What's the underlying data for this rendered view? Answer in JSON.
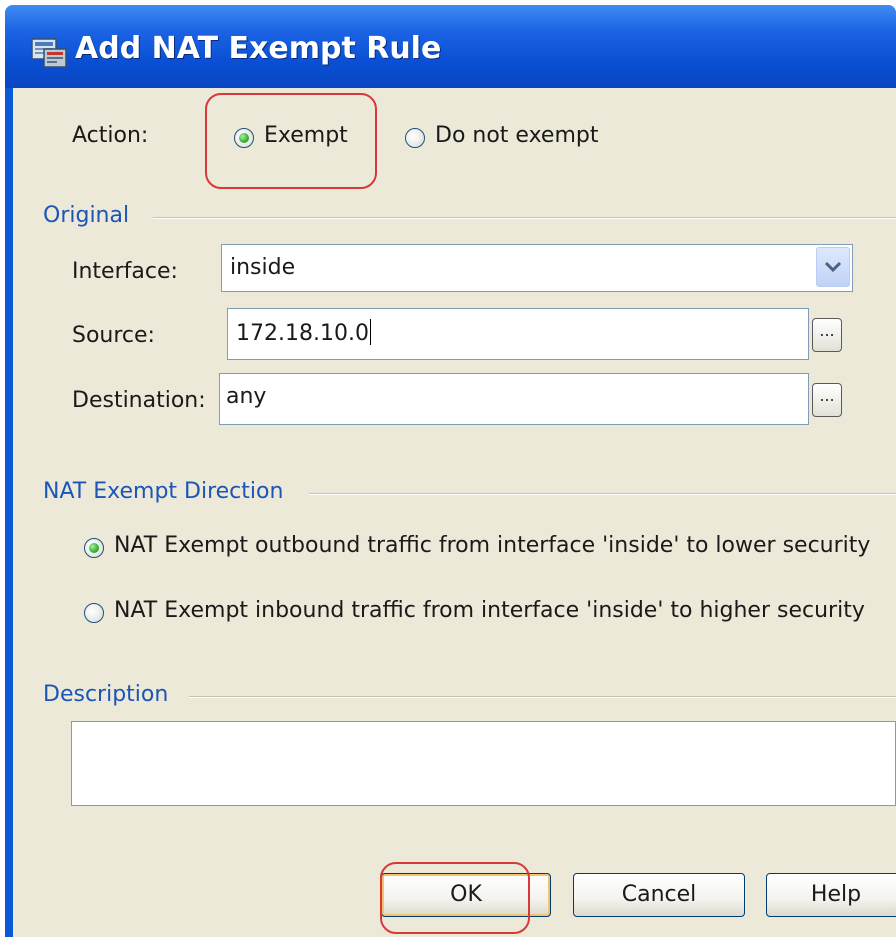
{
  "window": {
    "title": "Add NAT Exempt Rule"
  },
  "action": {
    "label": "Action:",
    "options": [
      {
        "label": "Exempt",
        "selected": true
      },
      {
        "label": "Do not exempt",
        "selected": false
      }
    ]
  },
  "original": {
    "group_title": "Original",
    "interface": {
      "label": "Interface:",
      "value": "inside"
    },
    "source": {
      "label": "Source:",
      "value": "172.18.10.0"
    },
    "destination": {
      "label": "Destination:",
      "value": "any"
    },
    "browse_label": "..."
  },
  "direction": {
    "group_title": "NAT Exempt Direction",
    "options": [
      {
        "label": "NAT Exempt outbound traffic from interface 'inside' to lower security",
        "selected": true
      },
      {
        "label": "NAT Exempt inbound traffic from interface 'inside' to higher security",
        "selected": false
      }
    ]
  },
  "description": {
    "group_title": "Description",
    "value": ""
  },
  "buttons": {
    "ok": "OK",
    "cancel": "Cancel",
    "help": "Help"
  },
  "colors": {
    "title_bar": "#0a4fd3",
    "dialog_bg": "#ece9d8",
    "group_title": "#1c55b8",
    "highlight": "#d8383a"
  }
}
